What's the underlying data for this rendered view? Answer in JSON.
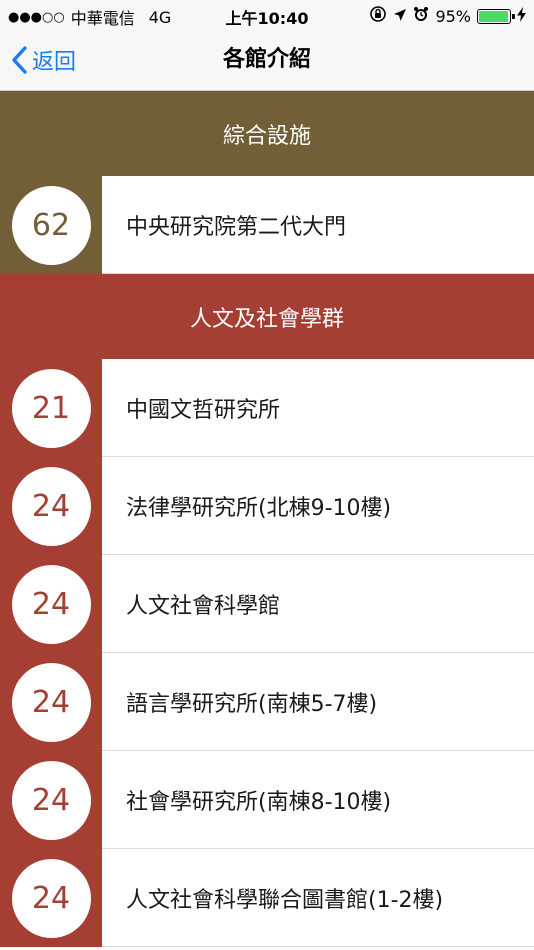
{
  "status_bar": {
    "signal": "●●●○○",
    "carrier": "中華電信",
    "network": "4G",
    "time": "上午10:40",
    "battery_percent": "95%",
    "battery_level": 0.95,
    "icons": [
      "orientation-lock-icon",
      "location-arrow-icon",
      "alarm-icon",
      "battery-icon",
      "charging-bolt-icon"
    ]
  },
  "nav": {
    "back_label": "返回",
    "title": "各館介紹"
  },
  "colors": {
    "general_section": "#735f37",
    "humanities_section": "#a63f33",
    "ios_blue": "#1a7cf5"
  },
  "sections": [
    {
      "title": "綜合設施",
      "color": "#735f37",
      "items": [
        {
          "number": "62",
          "label": "中央研究院第二代大門"
        }
      ]
    },
    {
      "title": "人文及社會學群",
      "color": "#a63f33",
      "items": [
        {
          "number": "21",
          "label": "中國文哲研究所"
        },
        {
          "number": "24",
          "label": "法律學研究所(北棟9-10樓)"
        },
        {
          "number": "24",
          "label": "人文社會科學館"
        },
        {
          "number": "24",
          "label": "語言學研究所(南棟5-7樓)"
        },
        {
          "number": "24",
          "label": "社會學研究所(南棟8-10樓)"
        },
        {
          "number": "24",
          "label": "人文社會科學聯合圖書館(1-2樓)"
        }
      ]
    }
  ]
}
